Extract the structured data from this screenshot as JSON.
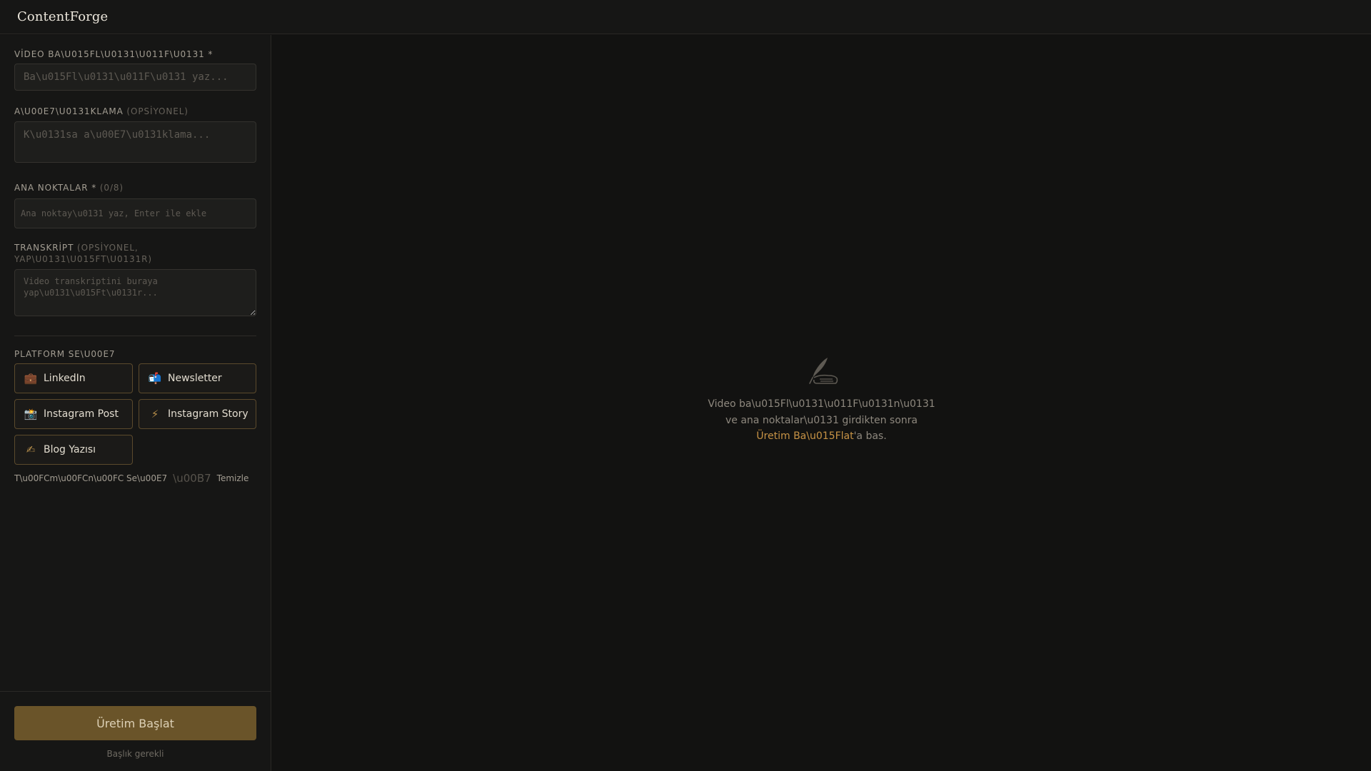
{
  "app": {
    "title": "ContentForge"
  },
  "form": {
    "title": {
      "label": "VİDEO BA\\U015FL\\U0131\\U011F\\U0131 *",
      "placeholder": "Ba\\u015Fl\\u0131\\u011F\\u0131 yaz..."
    },
    "description": {
      "label": "A\\U00E7\\U0131KLAMA",
      "label_muted": "(OPSİYONEL)",
      "placeholder": "K\\u0131sa a\\u00E7\\u0131klama..."
    },
    "key_points": {
      "label": "ANA NOKTALAR *",
      "count": "(0/8)",
      "placeholder": "Ana noktay\\u0131 yaz, Enter ile ekle"
    },
    "transcript": {
      "label": "TRANSKRİPT",
      "label_muted": "(OPSİYONEL, YAP\\U0131\\U015FT\\U0131R)",
      "placeholder": "Video transkriptini buraya yap\\u0131\\u015Ft\\u0131r..."
    }
  },
  "platforms": {
    "label": "PLATFORM SE\\U00E7",
    "items": [
      {
        "label": "LinkedIn",
        "icon": "briefcase-icon",
        "glyph": "💼"
      },
      {
        "label": "Newsletter",
        "icon": "mailbox-icon",
        "glyph": "📬"
      },
      {
        "label": "Instagram Post",
        "icon": "camera-icon",
        "glyph": "📸"
      },
      {
        "label": "Instagram Story",
        "icon": "lightning-icon",
        "glyph": "⚡"
      },
      {
        "label": "Blog Yazısı",
        "icon": "pencil-icon",
        "glyph": "✍"
      }
    ],
    "select_all": "T\\u00FCm\\u00FCn\\u00FC Se\\u00E7",
    "separator": "\\u00B7",
    "clear": "Temizle"
  },
  "footer": {
    "generate_label": "Üretim Başlat",
    "hint": "Başlık gerekli"
  },
  "empty_state": {
    "icon": "quill-hand-icon",
    "line1": "Video ba\\u015Fl\\u0131\\u011F\\u0131n\\u0131",
    "line2": "ve ana noktalar\\u0131 girdikten sonra",
    "accent": "Üretim Ba\\u015Flat",
    "suffix": "'a bas."
  },
  "colors": {
    "background": "#111110",
    "panel": "#161615",
    "accent": "#c79345",
    "button": "#6a5429",
    "border_accent": "#5b4a2c"
  }
}
